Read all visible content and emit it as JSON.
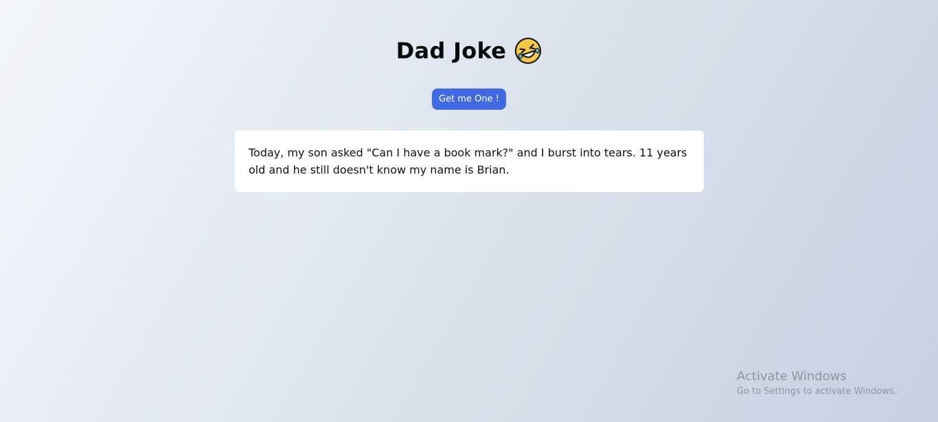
{
  "header": {
    "title": "Dad Joke",
    "emoji": "rolling-on-the-floor-laughing-icon"
  },
  "actions": {
    "get_joke_label": "Get me One !"
  },
  "joke": {
    "text": "Today, my son asked \"Can I have a book mark?\" and I burst into tears. 11 years old and he still doesn't know my name is Brian."
  },
  "colors": {
    "accent": "#4169e1",
    "card_bg": "#ffffff",
    "emoji_face": "#f7c94a"
  },
  "watermark": {
    "title": "Activate Windows",
    "subtitle": "Go to Settings to activate Windows."
  }
}
